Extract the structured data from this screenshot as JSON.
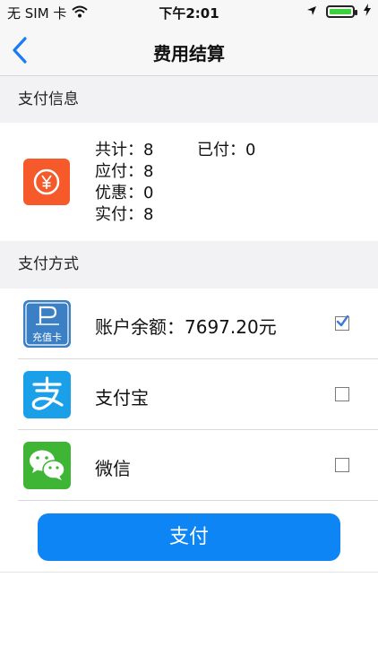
{
  "status_bar": {
    "carrier": "无 SIM 卡",
    "time": "下午2:01"
  },
  "nav": {
    "title": "费用结算"
  },
  "payment_info": {
    "header": "支付信息",
    "total": "共计：8",
    "paid": "已付：0",
    "payable": "应付：8",
    "discount": "优惠：0",
    "actual": "实付：8",
    "icon": "yen-icon"
  },
  "payment_method": {
    "header": "支付方式",
    "options": [
      {
        "label": "账户余额：7697.20元",
        "icon": "prepaid-card-icon",
        "icon_text": "充值卡",
        "checked": true
      },
      {
        "label": "支付宝",
        "icon": "alipay-icon",
        "checked": false
      },
      {
        "label": "微信",
        "icon": "wechat-icon",
        "checked": false
      }
    ]
  },
  "pay_button": {
    "label": "支付"
  },
  "colors": {
    "accent": "#0d85f5",
    "info_icon": "#f65a2b",
    "alipay": "#1aa0e8",
    "wechat": "#3eb535",
    "balance_icon": "#3b7fc4"
  }
}
